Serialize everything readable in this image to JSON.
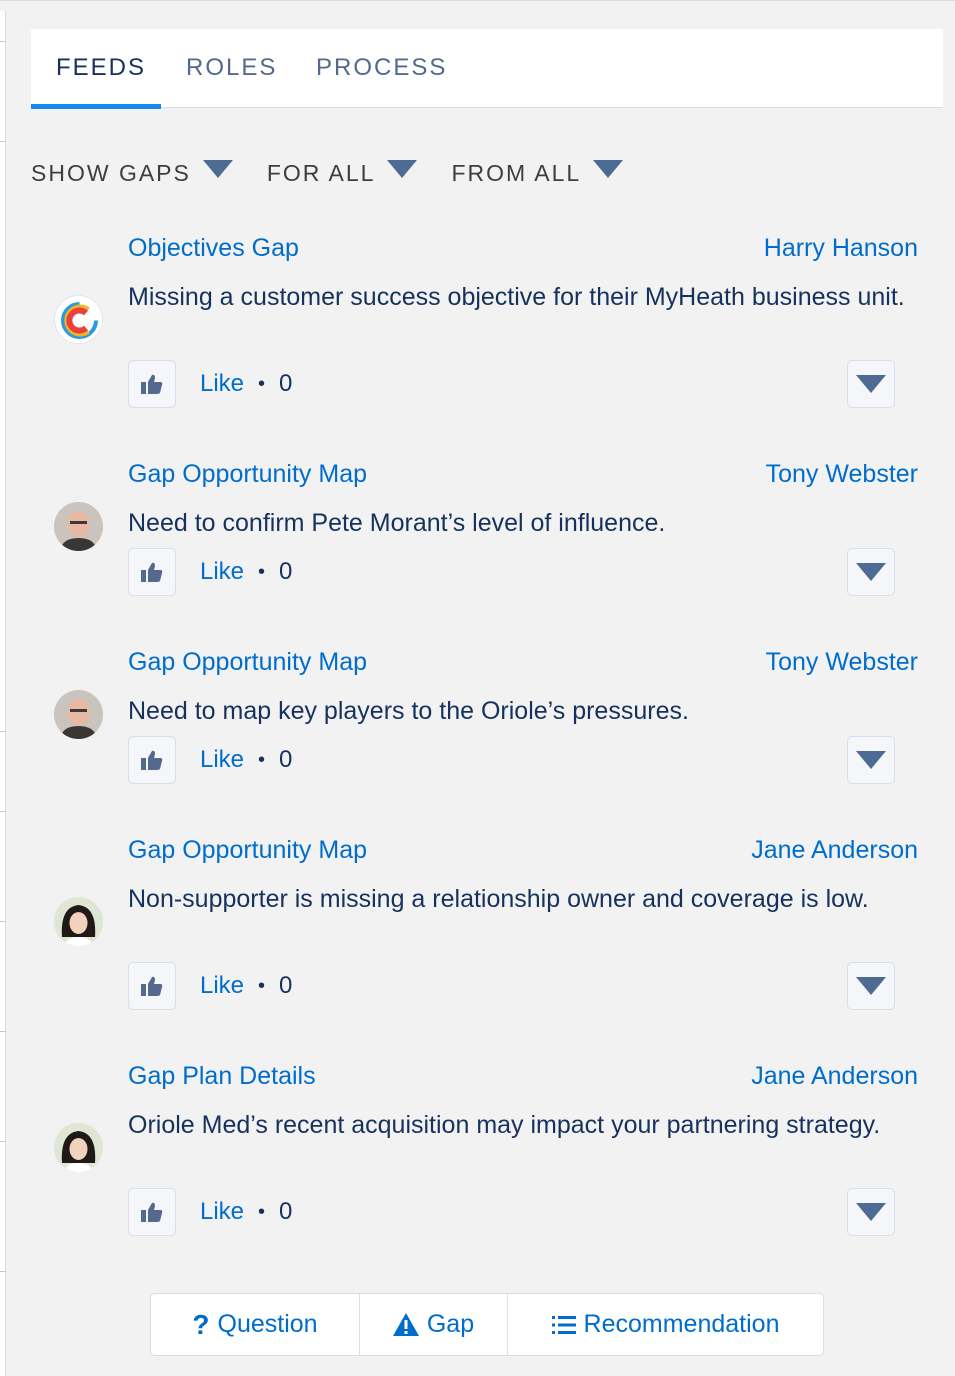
{
  "tabs": [
    {
      "label": "FEEDS",
      "active": true
    },
    {
      "label": "ROLES",
      "active": false
    },
    {
      "label": "PROCESS",
      "active": false
    }
  ],
  "filters": {
    "show": "SHOW GAPS",
    "for": "FOR ALL",
    "from": "FROM ALL"
  },
  "feed": [
    {
      "title": "Objectives Gap",
      "author": "Harry Hanson",
      "body": "Missing a customer success objective for their MyHeath business unit.",
      "like_label": "Like",
      "like_count": "0",
      "avatar": "company-logo"
    },
    {
      "title": "Gap Opportunity Map",
      "author": "Tony Webster",
      "body": "Need to confirm Pete Morant’s level of influence.",
      "like_label": "Like",
      "like_count": "0",
      "avatar": "man-avatar"
    },
    {
      "title": "Gap Opportunity Map",
      "author": "Tony Webster",
      "body": "Need to map key players to the Oriole’s pressures.",
      "like_label": "Like",
      "like_count": "0",
      "avatar": "man-avatar"
    },
    {
      "title": "Gap Opportunity Map",
      "author": "Jane Anderson",
      "body": "Non-supporter is missing a relationship owner and coverage is low.",
      "like_label": "Like",
      "like_count": "0",
      "avatar": "woman-avatar"
    },
    {
      "title": "Gap Plan Details",
      "author": "Jane Anderson",
      "body": "Oriole Med’s recent acquisition may impact your partnering strategy.",
      "like_label": "Like",
      "like_count": "0",
      "avatar": "woman-avatar"
    }
  ],
  "actions": {
    "question": "Question",
    "gap": "Gap",
    "recommendation": "Recommendation"
  },
  "colors": {
    "link": "#006dcc",
    "accent": "#1589ee",
    "caret": "#4e6b93"
  }
}
